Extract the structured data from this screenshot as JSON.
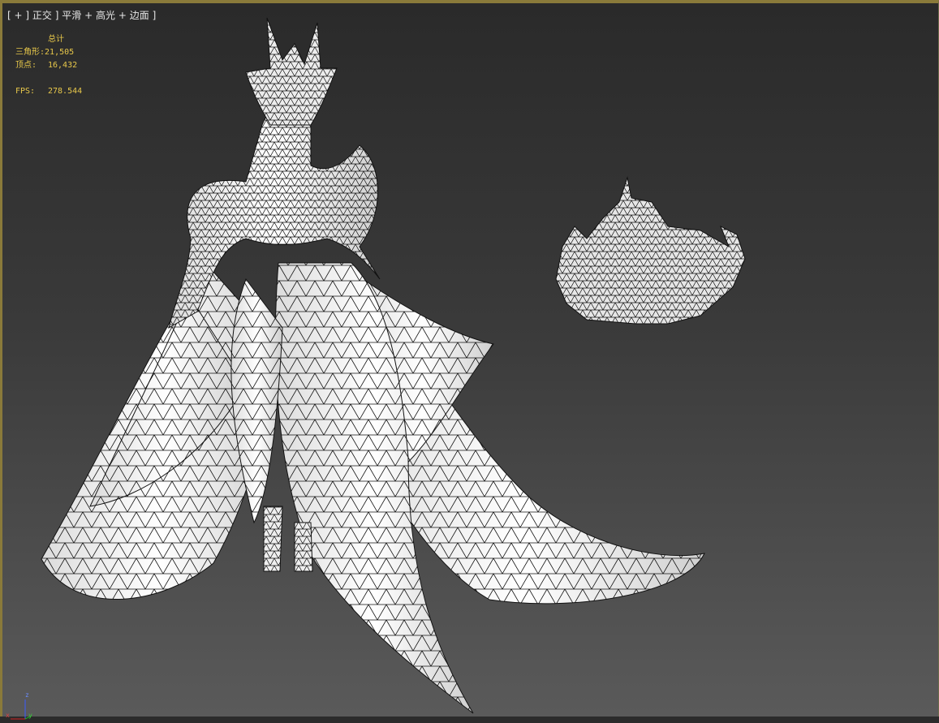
{
  "viewport": {
    "label_parts": [
      "[",
      "+",
      "]",
      "正交",
      "]",
      "平滑",
      "+",
      "高光",
      "+",
      "边面",
      "]"
    ]
  },
  "stats": {
    "header": "总计",
    "triangles_label": "三角形:",
    "triangles_value": "21,505",
    "vertices_label": "顶点:",
    "vertices_value": "16,432",
    "fps_label": "FPS:",
    "fps_value": "278.544"
  },
  "gizmo": {
    "x": "x",
    "y": "y",
    "z": "z"
  },
  "colors": {
    "stats_text": "#e8c84a",
    "mesh_fill": "#f2f2f2",
    "mesh_wire": "#111111",
    "viewport_border": "#8a7a3a"
  }
}
